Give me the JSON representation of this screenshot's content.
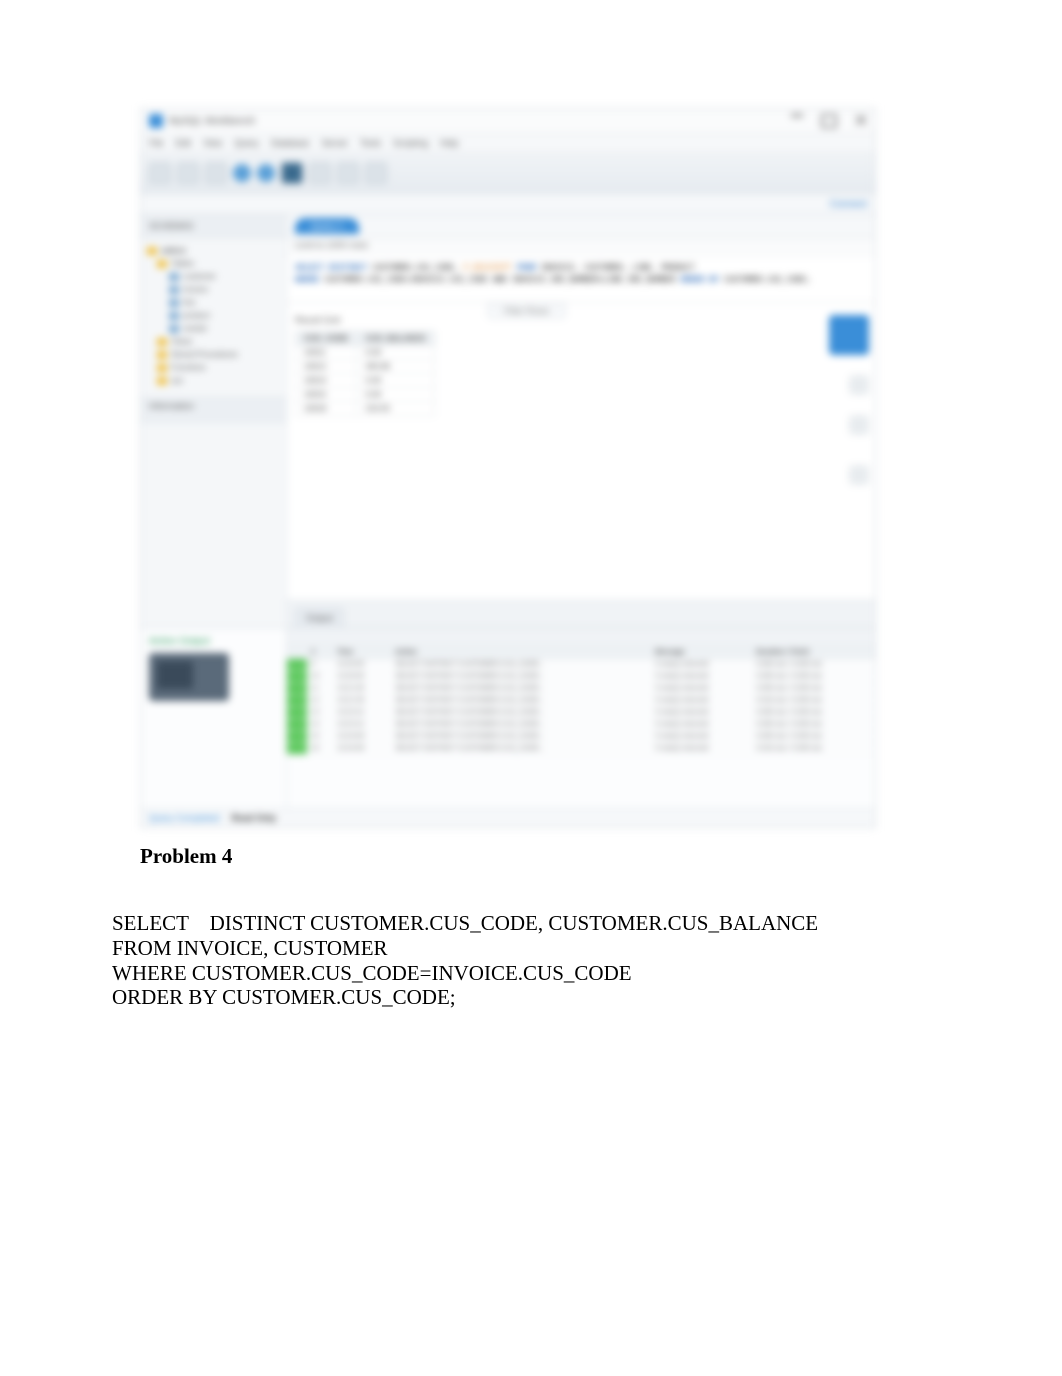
{
  "screenshot": {
    "titlebar": {
      "title": "MySQL Workbench"
    },
    "menubar": [
      "File",
      "Edit",
      "View",
      "Query",
      "Database",
      "Server",
      "Tools",
      "Scripting",
      "Help"
    ],
    "ribbon": {
      "label": "Connect"
    },
    "sidebar": {
      "header": "SCHEMAS",
      "footer": "Information",
      "nodes": [
        {
          "label": "saleco",
          "root": true
        },
        {
          "label": "Tables",
          "child": false
        },
        {
          "label": "customer",
          "child": true
        },
        {
          "label": "invoice",
          "child": true
        },
        {
          "label": "line",
          "child": true
        },
        {
          "label": "product",
          "child": true
        },
        {
          "label": "vendor",
          "child": true
        },
        {
          "label": "Views",
          "child": false
        },
        {
          "label": "Stored Procedures",
          "child": false
        },
        {
          "label": "Functions",
          "child": false
        },
        {
          "label": "sys",
          "child": false
        }
      ]
    },
    "tab": {
      "label": "Query 1"
    },
    "query_header": "Limit to 1000 rows",
    "query_text": {
      "line1": {
        "select": "SELECT DISTINCT",
        "rest1": " CUSTOMER.CUS_CODE,",
        "rest2": " P_DESCRIPT",
        "from": " FROM",
        "tables": " INVOICE, CUSTOMER, LINE, PRODUCT"
      },
      "line2": {
        "where": "WHERE",
        "cond": " CUSTOMER.CUS_CODE=INVOICE.CUS_CODE AND INVOICE.INV_NUMBER=LINE.INV_NUMBER",
        "order": " ORDER BY",
        "col": " CUSTOMER.CUS_CODE;"
      }
    },
    "results": {
      "label": "Result Grid",
      "info": "Filter Rows",
      "headers": [
        "CUS_CODE",
        "CUS_BALANCE"
      ],
      "rows": [
        [
          "10011",
          "0.00"
        ],
        [
          "10012",
          "345.86"
        ],
        [
          "10014",
          "0.00"
        ],
        [
          "10015",
          "0.00"
        ],
        [
          "10018",
          "216.55"
        ]
      ]
    },
    "bottom_tabs": [
      "Output"
    ],
    "action": {
      "label": "Action Output"
    },
    "output": {
      "headers": [
        "",
        "#",
        "Time",
        "Action",
        "Message",
        "Duration / Fetch"
      ],
      "rows": [
        [
          "",
          "9",
          "13:20:05",
          "SELECT DISTINCT CUSTOMER.CUS_CODE...",
          "5 row(s) returned",
          "0.000 sec / 0.000 sec"
        ],
        [
          "",
          "10",
          "13:20:05",
          "SELECT DISTINCT CUSTOMER.CUS_CODE...",
          "5 row(s) returned",
          "0.000 sec / 0.000 sec"
        ],
        [
          "",
          "11",
          "13:21:35",
          "SELECT DISTINCT CUSTOMER.CUS_CODE...",
          "5 row(s) returned",
          "0.000 sec / 0.000 sec"
        ],
        [
          "",
          "12",
          "13:21:35",
          "SELECT DISTINCT CUSTOMER.CUS_CODE...",
          "5 row(s) returned",
          "0.016 sec / 0.000 sec"
        ],
        [
          "",
          "13",
          "13:22:41",
          "SELECT DISTINCT CUSTOMER.CUS_CODE...",
          "5 row(s) returned",
          "0.000 sec / 0.000 sec"
        ],
        [
          "",
          "14",
          "13:22:41",
          "SELECT DISTINCT CUSTOMER.CUS_CODE...",
          "5 row(s) returned",
          "0.000 sec / 0.000 sec"
        ],
        [
          "",
          "15",
          "13:24:09",
          "SELECT DISTINCT CUSTOMER.CUS_CODE...",
          "5 row(s) returned",
          "0.000 sec / 0.000 sec"
        ],
        [
          "",
          "16",
          "13:24:09",
          "SELECT DISTINCT CUSTOMER.CUS_CODE...",
          "5 row(s) returned",
          "0.016 sec / 0.000 sec"
        ]
      ]
    },
    "statusbar": {
      "link": "Query Completed",
      "bold": "Read Only"
    }
  },
  "document": {
    "heading": "Problem 4",
    "sql": "SELECT    DISTINCT CUSTOMER.CUS_CODE, CUSTOMER.CUS_BALANCE\nFROM INVOICE, CUSTOMER\nWHERE CUSTOMER.CUS_CODE=INVOICE.CUS_CODE\nORDER BY CUSTOMER.CUS_CODE;"
  }
}
